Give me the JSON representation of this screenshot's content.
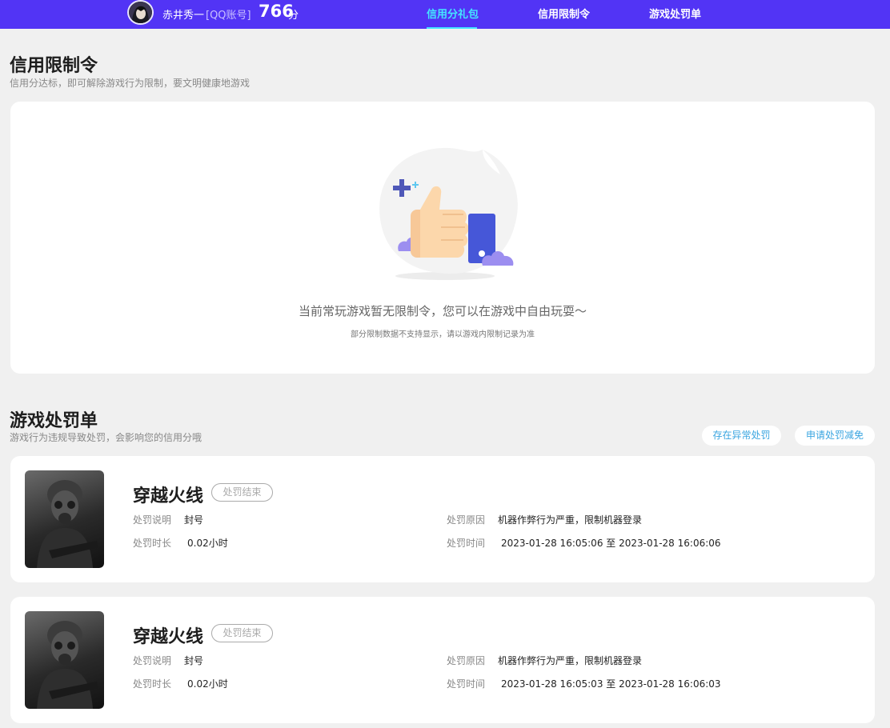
{
  "header": {
    "user_name": "赤井秀一",
    "account_type": "[QQ账号]",
    "score": "766",
    "score_unit": "分",
    "tabs": [
      {
        "label": "信用分礼包",
        "active": true
      },
      {
        "label": "信用限制令",
        "active": false
      },
      {
        "label": "游戏处罚单",
        "active": false
      }
    ]
  },
  "restriction": {
    "title": "信用限制令",
    "subtitle": "信用分达标，即可解除游戏行为限制，要文明健康地游戏",
    "empty_text": "当前常玩游戏暂无限制令，您可以在游戏中自由玩耍～",
    "empty_note": "部分限制数据不支持显示，请以游戏内限制记录为准"
  },
  "penalty": {
    "title": "游戏处罚单",
    "subtitle": "游戏行为违规导致处罚，会影响您的信用分哦",
    "appeal_button": "存在异常处罚",
    "reduce_button": "申请处罚减免",
    "labels": {
      "description": "处罚说明",
      "duration": "处罚时长",
      "reason": "处罚原因",
      "time": "处罚时间"
    },
    "records": [
      {
        "game": "穿越火线",
        "status": "处罚结束",
        "description": "封号",
        "duration": "0.02小时",
        "reason": "机器作弊行为严重，限制机器登录",
        "time": "2023-01-28 16:05:06 至 2023-01-28 16:06:06"
      },
      {
        "game": "穿越火线",
        "status": "处罚结束",
        "description": "封号",
        "duration": "0.02小时",
        "reason": "机器作弊行为严重，限制机器登录",
        "time": "2023-01-28 16:05:03 至 2023-01-28 16:06:03"
      }
    ]
  },
  "colors": {
    "header_bg": "#5234f5",
    "active_tab": "#44e6ff",
    "pill_text": "#3aa5e0"
  },
  "icons": [
    "avatar",
    "thumbs-up-illustration",
    "soldier-gas-mask-thumbnail"
  ]
}
